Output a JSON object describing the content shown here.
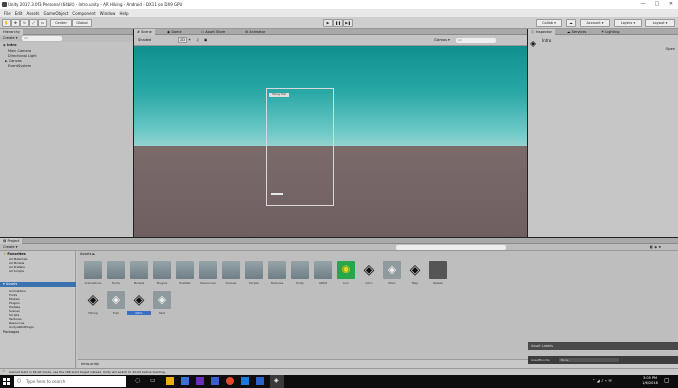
{
  "window": {
    "title": "Unity 2017.3.0f3 Personal (64bit) - Intro.unity - AR Hiking - Android - DX11 on DX9 GPU",
    "controls": [
      "—",
      "□",
      "✕"
    ]
  },
  "menubar": {
    "items": [
      "File",
      "Edit",
      "Assets",
      "GameObject",
      "Component",
      "Window",
      "Help"
    ]
  },
  "toolbar": {
    "pivot_label": "Center",
    "space_label": "Global",
    "play_icons": [
      "▶",
      "❚❚",
      "▶❚"
    ],
    "collab_label": "Collab ▾",
    "cloud_icon": "☁",
    "account_label": "Account ▾",
    "layers_label": "Layers ▾",
    "layout_label": "Layout ▾"
  },
  "hierarchy": {
    "tab_label": "Hierarchy",
    "create_label": "Create ▾",
    "search_placeholder": "All",
    "scene_name": "Intro",
    "items": [
      "Main Camera",
      "Directional Light",
      "Canvas",
      "EventSystem"
    ]
  },
  "scene_view": {
    "tabs": [
      "Scene",
      "Game",
      "Asset Store",
      "Animator"
    ],
    "shading_label": "Shaded",
    "mode_2d": "2D",
    "gizmos_label": "Gizmos ▾",
    "search_placeholder": "All",
    "ui_text": "Hiking Trail"
  },
  "inspector": {
    "tabs": [
      "Inspector",
      "Services",
      "Lighting"
    ],
    "object_name": "Intro",
    "open_label": "Open"
  },
  "project": {
    "tab_label": "Project",
    "create_label": "Create ▾",
    "tree": {
      "favorites_label": "Favorites",
      "favorites": [
        "All Materials",
        "All Models",
        "All Prefabs",
        "All Scripts"
      ],
      "assets_label": "Assets",
      "assets": [
        "Animations",
        "Fonts",
        "Models",
        "Plugins",
        "Prefabs",
        "Scenes",
        "Scripts",
        "Textures",
        "Resources",
        "UnityARKitPlugin"
      ],
      "packages_label": "Packages"
    },
    "breadcrumb": "Assets ►",
    "row1": [
      {
        "label": "Animations",
        "kind": "folder"
      },
      {
        "label": "Fonts",
        "kind": "folder"
      },
      {
        "label": "Models",
        "kind": "folder"
      },
      {
        "label": "Plugins",
        "kind": "folder"
      },
      {
        "label": "Prefabs",
        "kind": "folder"
      },
      {
        "label": "Resources",
        "kind": "folder"
      },
      {
        "label": "Scenes",
        "kind": "folder"
      },
      {
        "label": "Scripts",
        "kind": "folder"
      },
      {
        "label": "Textures",
        "kind": "folder"
      },
      {
        "label": "Unity",
        "kind": "folder"
      },
      {
        "label": "ARKit",
        "kind": "folder"
      },
      {
        "label": "Icon",
        "kind": "eye"
      },
      {
        "label": "Intro",
        "kind": "unity"
      },
      {
        "label": "Main",
        "kind": "unity-gray"
      },
      {
        "label": "Map",
        "kind": "unity"
      },
      {
        "label": "Splash",
        "kind": "dark"
      }
    ],
    "row2": [
      {
        "label": "Hiking",
        "kind": "unity"
      },
      {
        "label": "Trail",
        "kind": "unity-gray"
      },
      {
        "label": "Intro",
        "kind": "unity",
        "selected": true
      },
      {
        "label": "Test",
        "kind": "unity-gray"
      }
    ],
    "footer_path": "Intro.unity",
    "asset_labels_title": "Asset Labels",
    "asset_bundle_label": "AssetBundle",
    "asset_bundle_value": "None"
  },
  "status": {
    "message": "Cannot build in 64-bit mode, use the x86 build target instead. Unity will switch to 32-bit before building."
  },
  "taskbar": {
    "search_placeholder": "Type here to search",
    "time": "3:05 PM",
    "date": "1/6/2018"
  },
  "colors": {
    "accent_blue": "#3a72b0",
    "unity_icon_bg": "#cfd5d6",
    "selected_asset": "#3a6fc4",
    "eye_icon_green": "#2aa64a"
  }
}
